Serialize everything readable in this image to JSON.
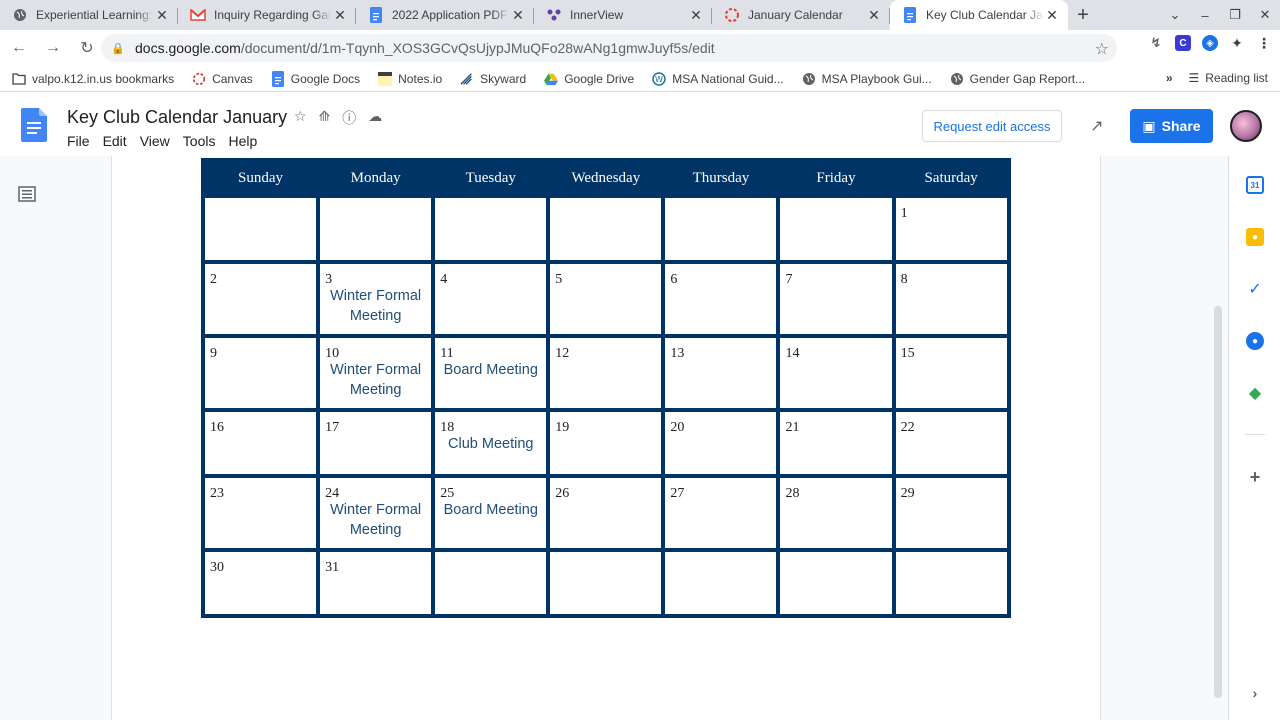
{
  "browser": {
    "tabs": [
      {
        "title": "Experiential Learning: F",
        "icon": "globe-icon",
        "active": false
      },
      {
        "title": "Inquiry Regarding Gam",
        "icon": "gmail-icon",
        "active": false
      },
      {
        "title": "2022 Application PDF",
        "icon": "docs-icon",
        "active": false
      },
      {
        "title": "InnerView",
        "icon": "innerview-icon",
        "active": false
      },
      {
        "title": "January Calendar",
        "icon": "canvas-icon",
        "active": false
      },
      {
        "title": "Key Club Calendar Jan",
        "icon": "docs-icon",
        "active": true
      }
    ],
    "new_tab": "+",
    "url_host": "docs.google.com",
    "url_path": "/document/d/1m-Tqynh_XOS3GCvQsUjypJMuQFo28wANg1gmwJuyf5s/edit",
    "bookmarks": [
      {
        "label": "valpo.k12.in.us bookmarks",
        "icon": "folder-icon"
      },
      {
        "label": "Canvas",
        "icon": "canvas-icon"
      },
      {
        "label": "Google Docs",
        "icon": "docs-icon"
      },
      {
        "label": "Notes.io",
        "icon": "notes-icon"
      },
      {
        "label": "Skyward",
        "icon": "skyward-icon"
      },
      {
        "label": "Google Drive",
        "icon": "drive-icon"
      },
      {
        "label": "MSA National Guid...",
        "icon": "wordpress-icon"
      },
      {
        "label": "MSA Playbook Gui...",
        "icon": "globe-icon"
      },
      {
        "label": "Gender Gap Report...",
        "icon": "globe-icon"
      }
    ],
    "more_bookmarks": "»",
    "reading_list": "Reading list"
  },
  "doc": {
    "title": "Key Club Calendar January",
    "menu": [
      "File",
      "Edit",
      "View",
      "Tools",
      "Help"
    ],
    "request_edit": "Request edit access",
    "share": "Share"
  },
  "calendar": {
    "days": [
      "Sunday",
      "Monday",
      "Tuesday",
      "Wednesday",
      "Thursday",
      "Friday",
      "Saturday"
    ],
    "weeks": [
      [
        {
          "n": "",
          "e": ""
        },
        {
          "n": "",
          "e": ""
        },
        {
          "n": "",
          "e": ""
        },
        {
          "n": "",
          "e": ""
        },
        {
          "n": "",
          "e": ""
        },
        {
          "n": "",
          "e": ""
        },
        {
          "n": "1",
          "e": ""
        }
      ],
      [
        {
          "n": "2",
          "e": ""
        },
        {
          "n": "3",
          "e": "Winter Formal Meeting"
        },
        {
          "n": "4",
          "e": ""
        },
        {
          "n": "5",
          "e": ""
        },
        {
          "n": "6",
          "e": ""
        },
        {
          "n": "7",
          "e": ""
        },
        {
          "n": "8",
          "e": ""
        }
      ],
      [
        {
          "n": "9",
          "e": ""
        },
        {
          "n": "10",
          "e": "Winter Formal Meeting"
        },
        {
          "n": "11",
          "e": "Board Meeting"
        },
        {
          "n": "12",
          "e": ""
        },
        {
          "n": "13",
          "e": ""
        },
        {
          "n": "14",
          "e": ""
        },
        {
          "n": "15",
          "e": ""
        }
      ],
      [
        {
          "n": "16",
          "e": ""
        },
        {
          "n": "17",
          "e": ""
        },
        {
          "n": "18",
          "e": "Club Meeting"
        },
        {
          "n": "19",
          "e": ""
        },
        {
          "n": "20",
          "e": ""
        },
        {
          "n": "21",
          "e": ""
        },
        {
          "n": "22",
          "e": ""
        }
      ],
      [
        {
          "n": "23",
          "e": ""
        },
        {
          "n": "24",
          "e": "Winter Formal Meeting"
        },
        {
          "n": "25",
          "e": "Board Meeting"
        },
        {
          "n": "26",
          "e": ""
        },
        {
          "n": "27",
          "e": ""
        },
        {
          "n": "28",
          "e": ""
        },
        {
          "n": "29",
          "e": ""
        }
      ],
      [
        {
          "n": "30",
          "e": ""
        },
        {
          "n": "31",
          "e": ""
        },
        {
          "n": "",
          "e": ""
        },
        {
          "n": "",
          "e": ""
        },
        {
          "n": "",
          "e": ""
        },
        {
          "n": "",
          "e": ""
        },
        {
          "n": "",
          "e": ""
        }
      ]
    ]
  },
  "colors": {
    "calendar_navy": "#003366",
    "event_text": "#1f4e79",
    "share_blue": "#1a73e8"
  },
  "side_panel": [
    "calendar-icon",
    "keep-icon",
    "tasks-icon",
    "contacts-icon",
    "maps-icon",
    "add-icon"
  ]
}
